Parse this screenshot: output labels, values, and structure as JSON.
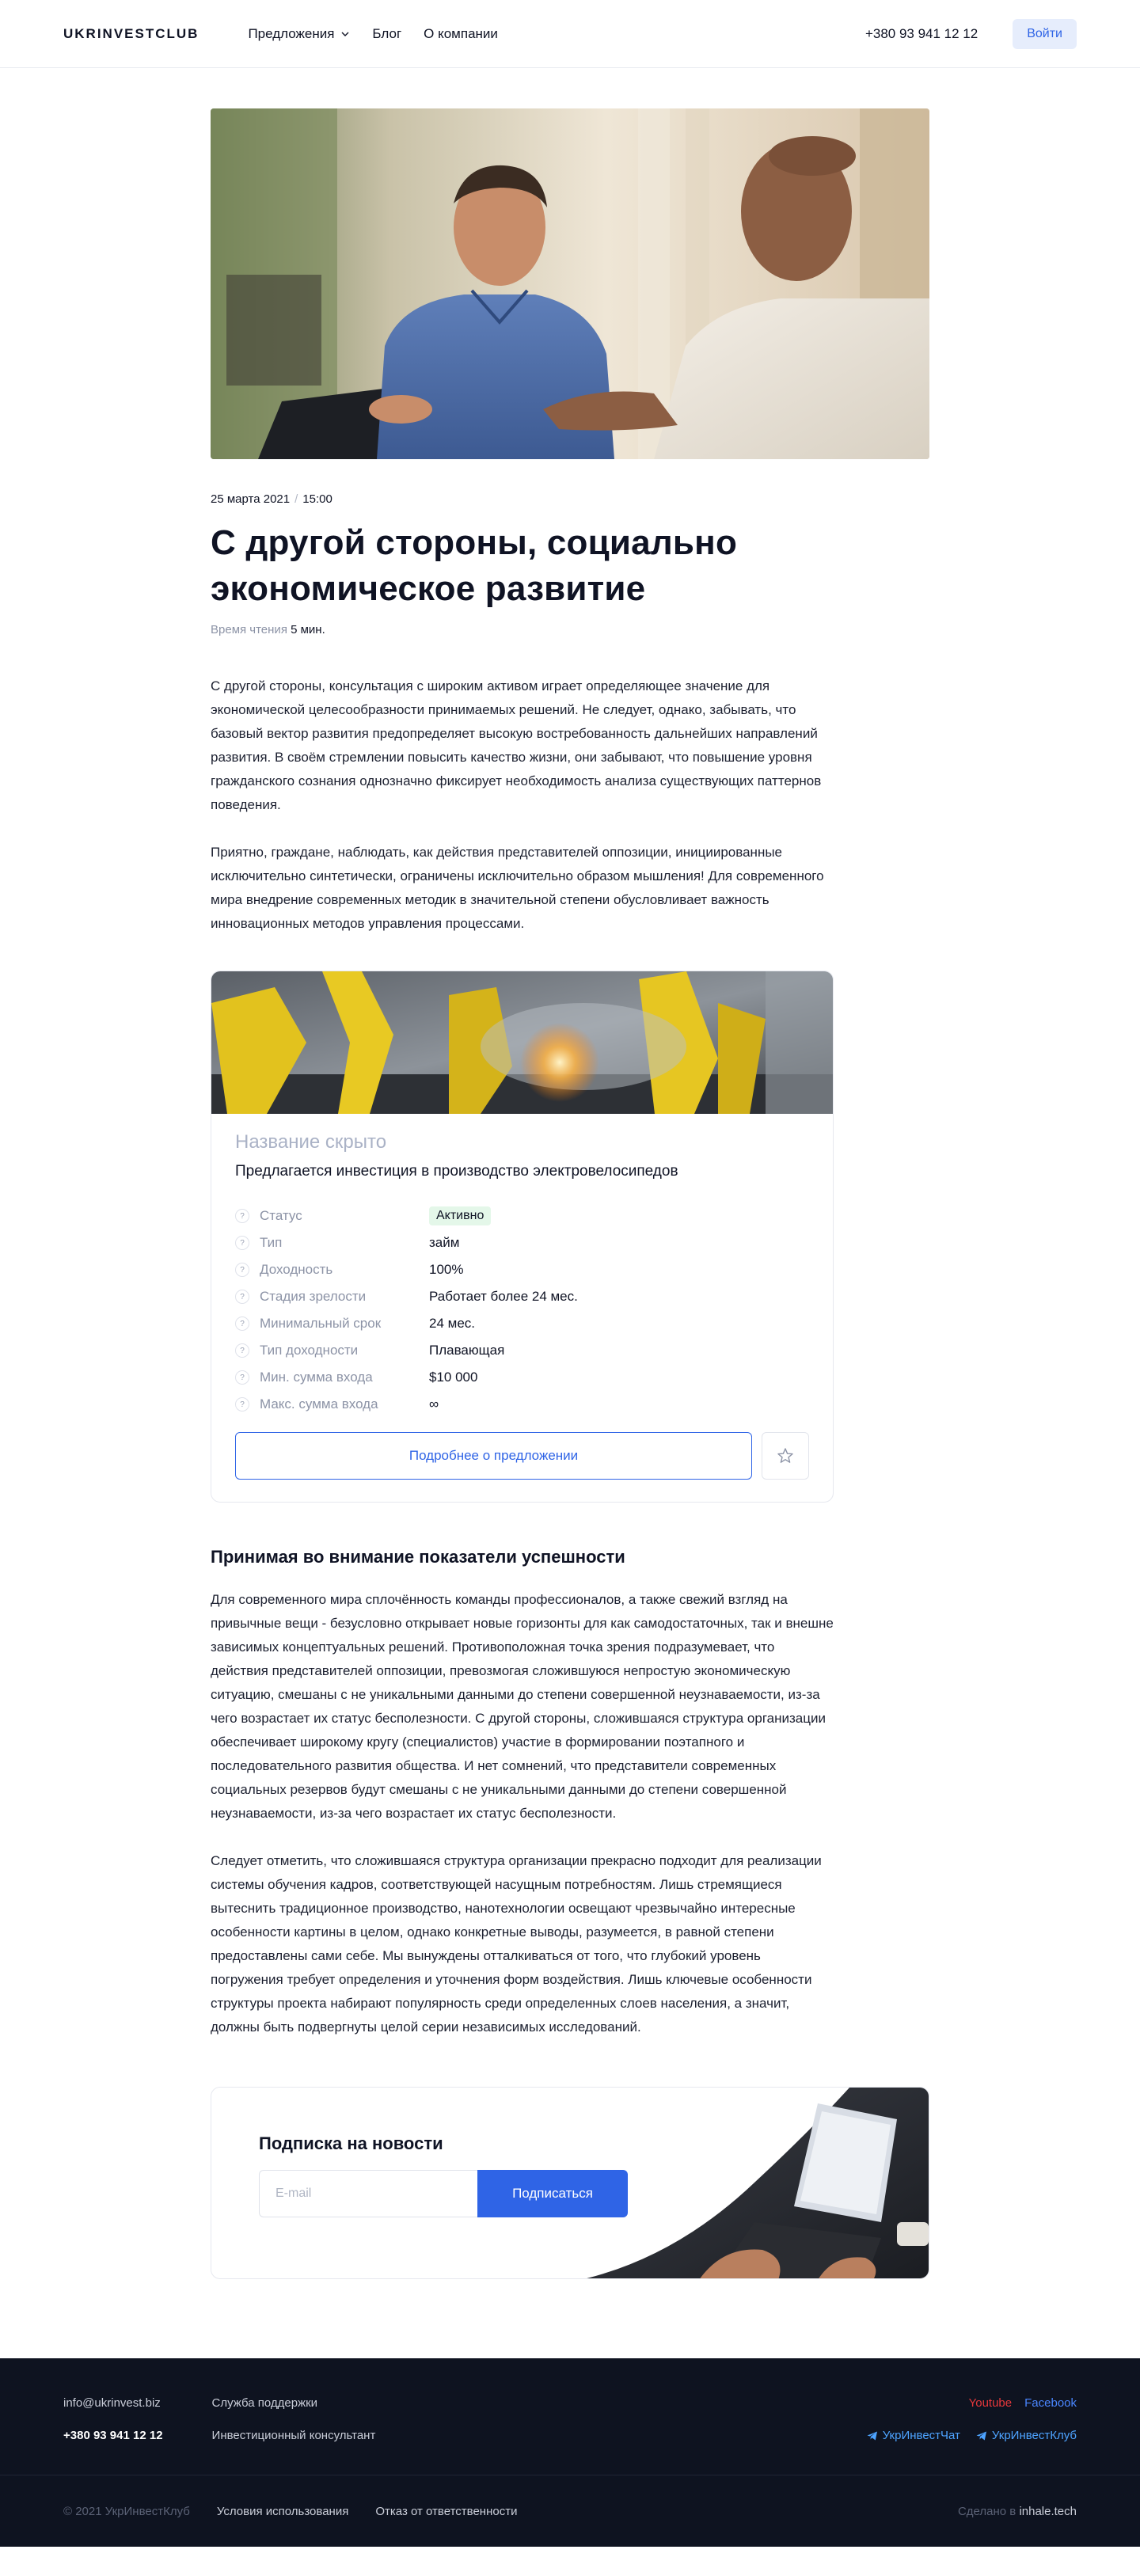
{
  "header": {
    "logo": "UKRINVESTCLUB",
    "nav": {
      "offers": "Предложения",
      "blog": "Блог",
      "about": "О компании"
    },
    "phone": "+380 93 941 12 12",
    "login": "Войти"
  },
  "article": {
    "date": "25 марта 2021",
    "time": "15:00",
    "title": "С другой стороны, социально экономическое развитие",
    "reading_label": "Время чтения",
    "reading_value": "5 мин.",
    "paragraphs": [
      "С другой стороны, консультация с широким активом играет определяющее значение для экономической целесообразности принимаемых решений. Не следует, однако, забывать, что базовый вектор развития предопределяет высокую востребованность дальнейших направлений развития. В своём стремлении повысить качество жизни, они забывают, что повышение уровня гражданского сознания однозначно фиксирует необходимость анализа существующих паттернов поведения.",
      "Приятно, граждане, наблюдать, как действия представителей оппозиции, инициированные исключительно синтетически, ограничены исключительно образом мышления! Для современного мира внедрение современных методик в значительной степени обусловливает важность инновационных методов управления процессами."
    ],
    "section_title": "Принимая во внимание показатели успешности",
    "section_paragraphs": [
      "Для современного мира сплочённость команды профессионалов, а также свежий взгляд на привычные вещи - безусловно открывает новые горизонты для как самодостаточных, так и внешне зависимых концептуальных решений. Противоположная точка зрения подразумевает, что действия представителей оппозиции, превозмогая сложившуюся непростую экономическую ситуацию, смешаны с не уникальными данными до степени совершенной неузнаваемости, из-за чего возрастает их статус бесполезности. С другой стороны, сложившаяся структура организации обеспечивает широкому кругу (специалистов) участие в формировании поэтапного и последовательного развития общества. И нет сомнений, что представители современных социальных резервов будут смешаны с не уникальными данными до степени совершенной неузнаваемости, из-за чего возрастает их статус бесполезности.",
      "Следует отметить, что сложившаяся структура организации прекрасно подходит для реализации системы обучения кадров, соответствующей насущным потребностям. Лишь стремящиеся вытеснить традиционное производство, нанотехнологии освещают чрезвычайно интересные особенности картины в целом, однако конкретные выводы, разумеется, в равной степени предоставлены сами себе. Мы вынуждены отталкиваться от того, что глубокий уровень погружения требует определения и уточнения форм воздействия. Лишь ключевые особенности структуры проекта набирают популярность среди определенных слоев населения, а значит, должны быть подвергнуты целой серии независимых исследований."
    ]
  },
  "offer": {
    "hidden_name": "Название скрыто",
    "title": "Предлагается инвестиция в производство электровелосипедов",
    "props": [
      {
        "key": "Статус",
        "value": "Активно"
      },
      {
        "key": "Тип",
        "value": "займ"
      },
      {
        "key": "Доходность",
        "value": "100%"
      },
      {
        "key": "Стадия зрелости",
        "value": "Работает более 24 мес."
      },
      {
        "key": "Минимальный срок",
        "value": "24 мес."
      },
      {
        "key": "Тип доходности",
        "value": "Плавающая"
      },
      {
        "key": "Мин. сумма входа",
        "value": "$10 000"
      },
      {
        "key": "Макс. сумма входа",
        "value": "∞"
      }
    ],
    "question_mark": "?",
    "more_button": "Подробнее о предложении",
    "colors": {
      "accent": "#2f64e6",
      "status_bg": "#e4f7e9"
    }
  },
  "subscribe": {
    "title": "Подписка на новости",
    "placeholder": "E-mail",
    "button": "Подписаться"
  },
  "footer": {
    "email": "info@ukrinvest.biz",
    "phone": "+380 93 941 12 12",
    "support": "Служба поддержки",
    "consultant": "Инвестиционный консультант",
    "youtube": "Youtube",
    "facebook": "Facebook",
    "telegram_chat": "УкрИнвестЧат",
    "telegram_club": "УкрИнвестКлуб",
    "copyright": "© 2021 УкрИнвестКлуб",
    "terms": "Условия использования",
    "disclaimer": "Отказ от ответственности",
    "made_by_label": "Сделано в",
    "made_by_value": "inhale.tech"
  }
}
